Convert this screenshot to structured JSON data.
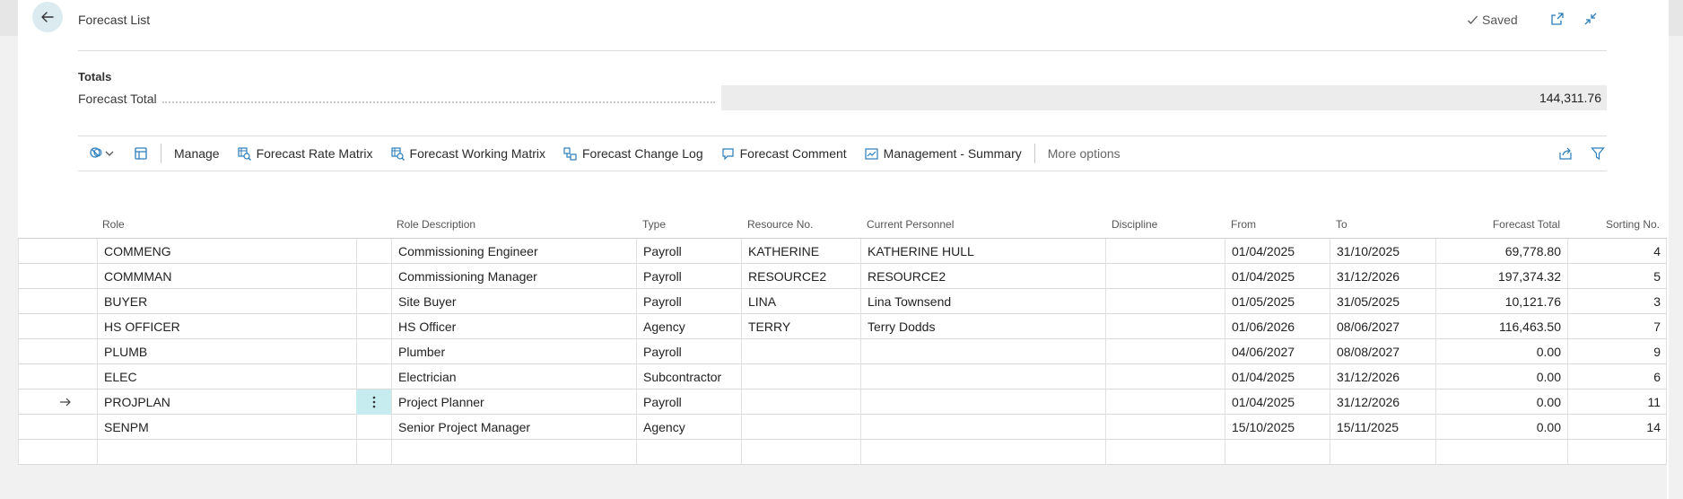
{
  "header": {
    "title": "Forecast List",
    "saved_label": "Saved",
    "icons": [
      "back-arrow-icon",
      "open-new-window-icon",
      "collapse-icon",
      "checkmark-icon"
    ]
  },
  "totals": {
    "caption": "Totals",
    "forecast_total_label": "Forecast Total",
    "forecast_total_value": "144,311.76"
  },
  "actions": {
    "manage": "Manage",
    "rate_matrix": "Forecast Rate Matrix",
    "working_matrix": "Forecast Working Matrix",
    "change_log": "Forecast Change Log",
    "comment": "Forecast Comment",
    "summary": "Management - Summary",
    "more": "More options"
  },
  "columns": {
    "role": "Role",
    "role_description": "Role Description",
    "type": "Type",
    "resource_no": "Resource No.",
    "current_personnel": "Current Personnel",
    "discipline": "Discipline",
    "from": "From",
    "to": "To",
    "forecast_total": "Forecast Total",
    "sorting_no": "Sorting No."
  },
  "rows": [
    {
      "role": "COMMENG",
      "desc": "Commissioning Engineer",
      "type": "Payroll",
      "res": "KATHERINE",
      "pers": "KATHERINE HULL",
      "disc": "",
      "from": "01/04/2025",
      "to": "31/10/2025",
      "total": "69,778.80",
      "sort": "4"
    },
    {
      "role": "COMMMAN",
      "desc": "Commissioning Manager",
      "type": "Payroll",
      "res": "RESOURCE2",
      "pers": "RESOURCE2",
      "disc": "",
      "from": "01/04/2025",
      "to": "31/12/2026",
      "total": "197,374.32",
      "sort": "5"
    },
    {
      "role": "BUYER",
      "desc": "Site Buyer",
      "type": "Payroll",
      "res": "LINA",
      "pers": "Lina Townsend",
      "disc": "",
      "from": "01/05/2025",
      "to": "31/05/2025",
      "total": "10,121.76",
      "sort": "3"
    },
    {
      "role": "HS OFFICER",
      "desc": "HS Officer",
      "type": "Agency",
      "res": "TERRY",
      "pers": "Terry Dodds",
      "disc": "",
      "from": "01/06/2026",
      "to": "08/06/2027",
      "total": "116,463.50",
      "sort": "7"
    },
    {
      "role": "PLUMB",
      "desc": "Plumber",
      "type": "Payroll",
      "res": "",
      "pers": "",
      "disc": "",
      "from": "04/06/2027",
      "to": "08/08/2027",
      "total": "0.00",
      "sort": "9"
    },
    {
      "role": "ELEC",
      "desc": "Electrician",
      "type": "Subcontractor",
      "res": "",
      "pers": "",
      "disc": "",
      "from": "01/04/2025",
      "to": "31/12/2026",
      "total": "0.00",
      "sort": "6"
    },
    {
      "role": "PROJPLAN",
      "desc": "Project Planner",
      "type": "Payroll",
      "res": "",
      "pers": "",
      "disc": "",
      "from": "01/04/2025",
      "to": "31/12/2026",
      "total": "0.00",
      "sort": "11"
    },
    {
      "role": "SENPM",
      "desc": "Senior Project Manager",
      "type": "Agency",
      "res": "",
      "pers": "",
      "disc": "",
      "from": "15/10/2025",
      "to": "15/11/2025",
      "total": "0.00",
      "sort": "14"
    },
    {
      "role": "",
      "desc": "",
      "type": "",
      "res": "",
      "pers": "",
      "disc": "",
      "from": "",
      "to": "",
      "total": "",
      "sort": ""
    }
  ],
  "selected_row_index": 6
}
